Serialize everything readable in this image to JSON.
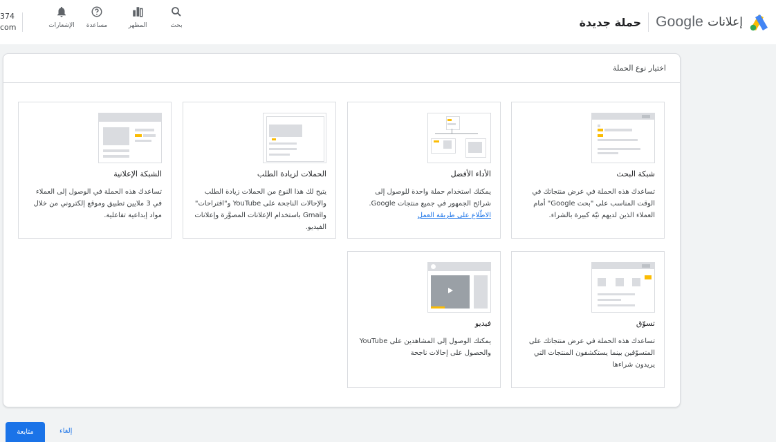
{
  "header": {
    "brand_ar": "إعلانات",
    "brand_google": "Google",
    "page_title": "حملة جديدة",
    "account_line1": "374",
    "account_line2": "com",
    "tools": [
      {
        "icon": "search-icon",
        "label": "بحث"
      },
      {
        "icon": "appearance-icon",
        "label": "المظهر"
      },
      {
        "icon": "help-icon",
        "label": "مساعدة"
      },
      {
        "icon": "notifications-icon",
        "label": "الإشعارات"
      }
    ]
  },
  "panel": {
    "heading": "اختيار نوع الحملة",
    "cards": [
      {
        "title": "شبكة البحث",
        "desc": "تساعدك هذه الحملة في عرض منتجاتك في الوقت المناسب على \"بحث Google\" أمام العملاء الذين لديهم نيّة كبيرة بالشراء."
      },
      {
        "title": "الأداء الأفضل",
        "desc": "يمكنك استخدام حملة واحدة للوصول إلى شرائح الجمهور في جميع منتجات Google.",
        "link": "الاطّلاع على طريقة العمل"
      },
      {
        "title": "الحملات لزيادة الطلب",
        "desc": "يتيح لك هذا النوع من الحملات زيادة الطلب والإحالات الناجحة على YouTube و\"اقتراحات\" وGmail باستخدام الإعلانات المصوَّرة وإعلانات الفيديو."
      },
      {
        "title": "الشبكة الإعلانية",
        "desc": "تساعدك هذه الحملة في الوصول إلى العملاء في 3 ملايين تطبيق وموقع إلكتروني من خلال مواد إبداعية تفاعلية."
      },
      {
        "title": "تسوّق",
        "desc": "تساعدك هذه الحملة في عرض منتجاتك على المتسوّقين بينما يستكشفون المنتجات التي يريدون شراءها"
      },
      {
        "title": "فيديو",
        "desc": "يمكنك الوصول إلى المشاهدين على YouTube والحصول على إحالات ناجحة"
      }
    ]
  },
  "footer": {
    "continue_label": "متابعة",
    "cancel_label": "إلغاء"
  },
  "colors": {
    "accent": "#1a73e8",
    "highlight": "#fbbc04"
  }
}
